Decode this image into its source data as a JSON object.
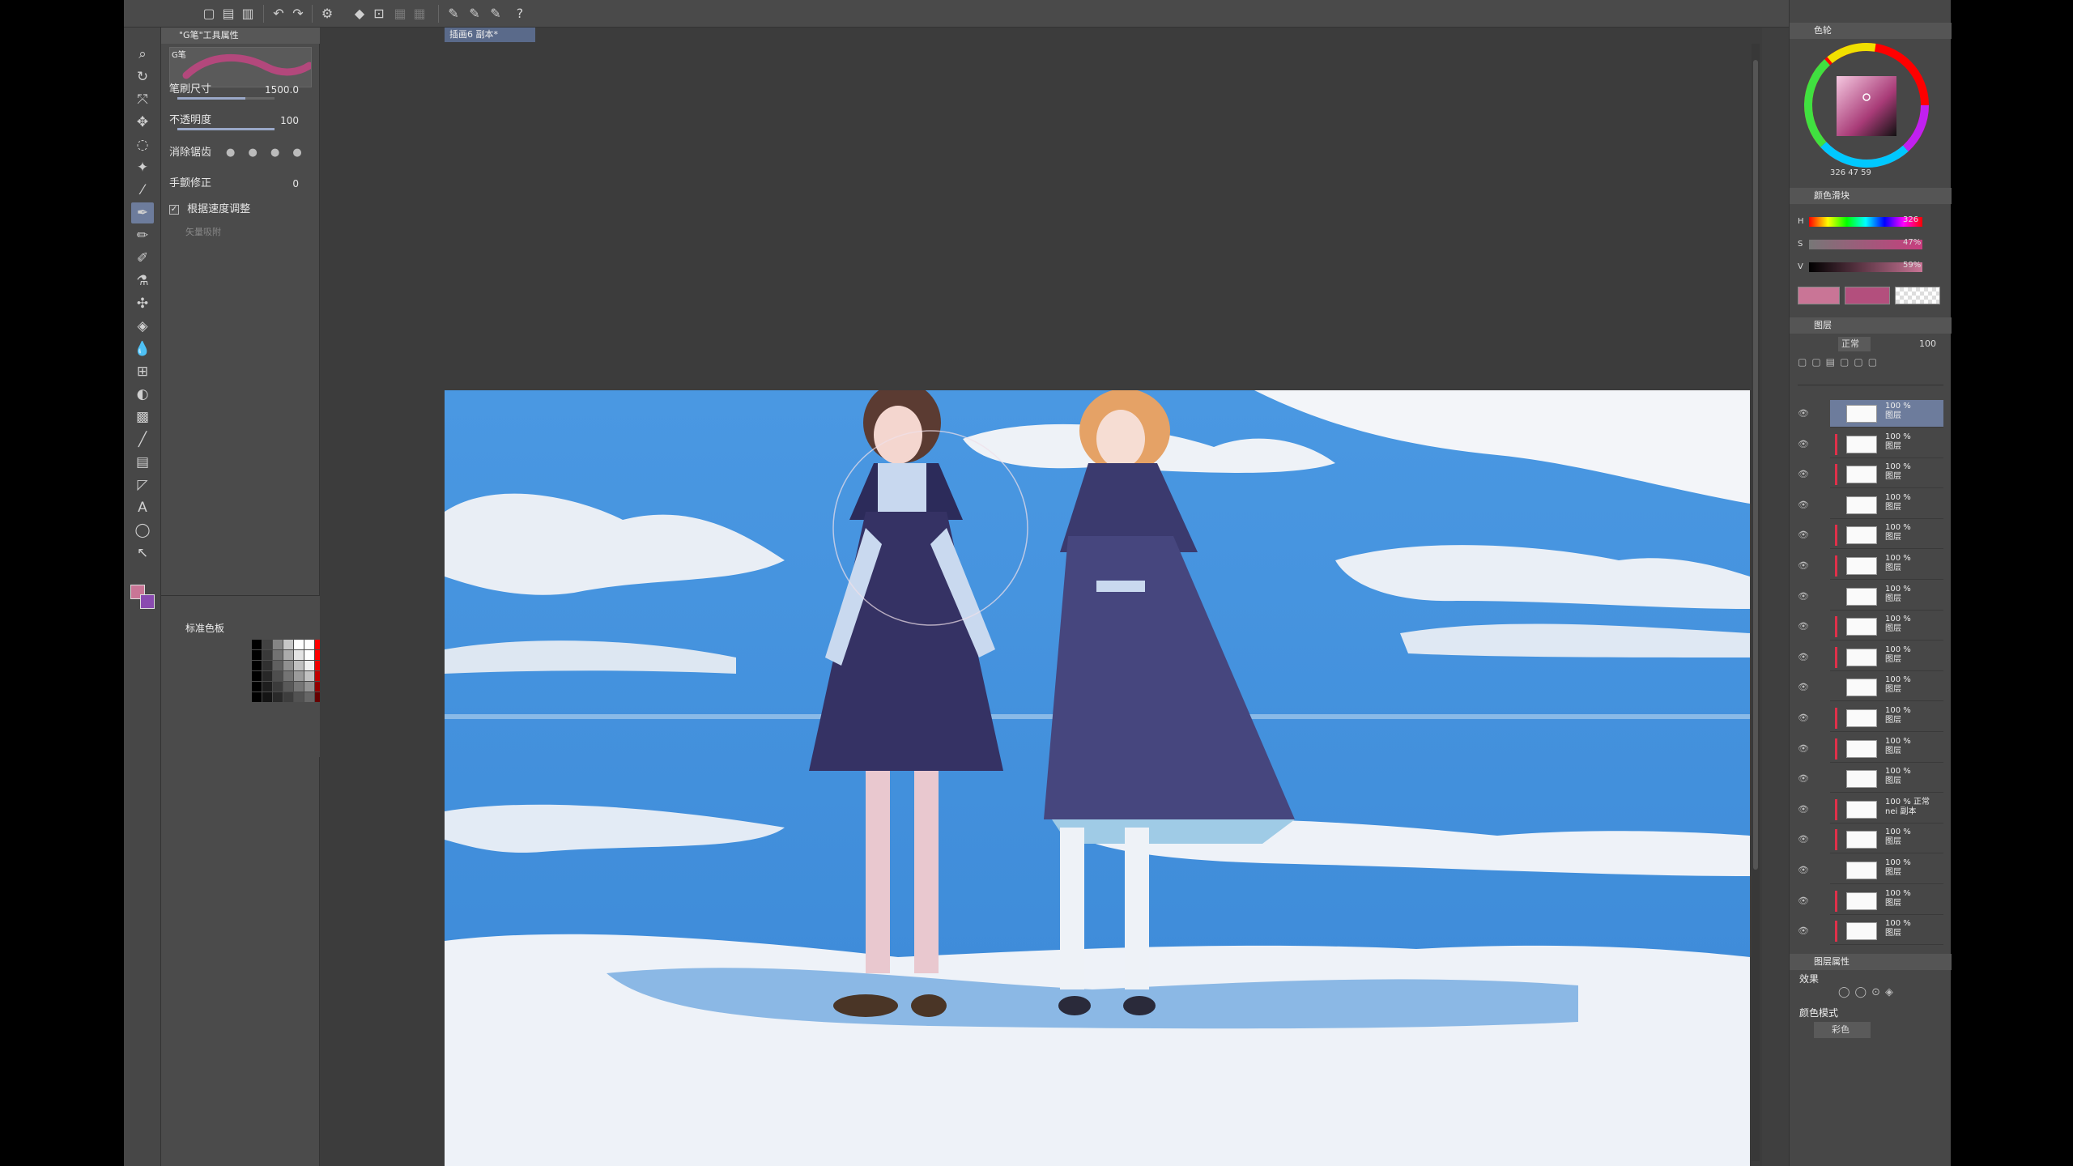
{
  "toolbar": {
    "icons": [
      "new-file",
      "open-file",
      "save",
      "undo",
      "redo",
      "transform",
      "fill",
      "crop",
      "ruler",
      "pen-a",
      "pen-b",
      "pen-c",
      "help"
    ]
  },
  "tools": [
    "zoom",
    "move",
    "rotate",
    "select-move",
    "lasso",
    "auto-select",
    "eyedropper",
    "pen",
    "pencil",
    "brush",
    "airbrush",
    "decoration",
    "eraser",
    "blend",
    "fill",
    "gradient",
    "figure",
    "frame",
    "balloon",
    "text",
    "correction-line"
  ],
  "subtool": {
    "title": "\"G笔\"工具属性",
    "tab": "G笔",
    "brush_size_label": "笔刷尺寸",
    "brush_size_value": "1500.0",
    "opacity_label": "不透明度",
    "opacity_value": "100",
    "anti_alias_label": "消除锯齿",
    "stabilization_label": "手颤修正",
    "stabilization_value": "0",
    "speed_label": "根据速度调整",
    "vector_label": "矢量吸附"
  },
  "palette": {
    "title": "标准色板"
  },
  "document": {
    "tab": "插画6 副本*"
  },
  "color": {
    "panel_title": "色轮",
    "readout": "326  47  59",
    "slider_panel_title": "颜色滑块",
    "h_label": "H",
    "h_value": "326",
    "s_label": "S",
    "s_value": "47%",
    "v_label": "V",
    "v_value": "59%",
    "main": "#c97596",
    "sub": "#b34f7d"
  },
  "layers": {
    "panel_title": "图层",
    "blend": "正常",
    "opacity": "100",
    "items": [
      {
        "pct": "100 %",
        "name": "图层"
      },
      {
        "pct": "100 %",
        "name": "图层"
      },
      {
        "pct": "100 %",
        "name": "图层"
      },
      {
        "pct": "100 %",
        "name": "图层"
      },
      {
        "pct": "100 %",
        "name": "图层"
      },
      {
        "pct": "100 %",
        "name": "图层"
      },
      {
        "pct": "100 %",
        "name": "图层"
      },
      {
        "pct": "100 %",
        "name": "图层"
      },
      {
        "pct": "100 %",
        "name": "图层"
      },
      {
        "pct": "100 %",
        "name": "图层"
      },
      {
        "pct": "100 %",
        "name": "图层"
      },
      {
        "pct": "100 %",
        "name": "图层"
      },
      {
        "pct": "100 %",
        "name": "图层"
      },
      {
        "pct": "100 % 正常",
        "name": "nei 副本"
      },
      {
        "pct": "100 %",
        "name": "图层"
      },
      {
        "pct": "100 %",
        "name": "图层"
      },
      {
        "pct": "100 %",
        "name": "图层"
      },
      {
        "pct": "100 %",
        "name": "图层"
      }
    ]
  },
  "properties": {
    "panel_title": "图层属性",
    "effect_label": "效果",
    "color_mode_label": "颜色模式",
    "color_mode_value": "彩色"
  }
}
